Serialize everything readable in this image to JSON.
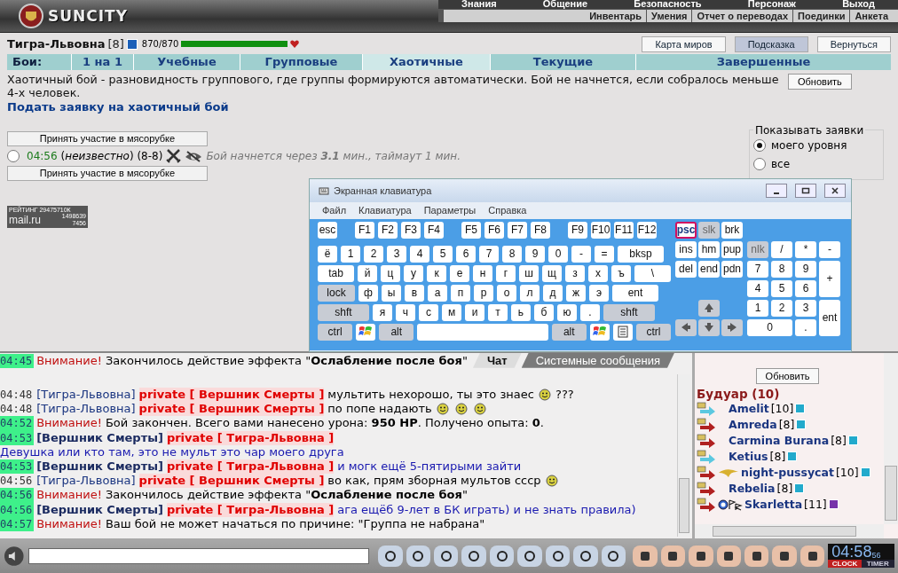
{
  "header": {
    "logo": "SUNCITY",
    "menu_top": [
      "Знания",
      "Общение",
      "Безопасность",
      "Персонаж",
      "Выход"
    ],
    "menu_bottom": [
      "Инвентарь",
      "Умения",
      "Отчет о переводах",
      "Поединки",
      "Анкета"
    ]
  },
  "player": {
    "name": "Тигра-Львовна",
    "rank": "[8]",
    "hp": "870/870",
    "hp_bar": {
      "level": 1
    }
  },
  "top_buttons": [
    {
      "label": "Карта миров",
      "selected": false
    },
    {
      "label": "Подсказка",
      "selected": true
    },
    {
      "label": "Вернуться",
      "selected": false
    }
  ],
  "fight_tabs": {
    "label": "Бои:",
    "tabs": [
      {
        "label": "1 на 1",
        "selected": false
      },
      {
        "label": "Учебные",
        "selected": false
      },
      {
        "label": "Групповые",
        "selected": false
      },
      {
        "label": "Хаотичные",
        "selected": true
      },
      {
        "label": "Текущие",
        "selected": false
      },
      {
        "label": "Завершенные",
        "selected": false
      }
    ]
  },
  "description": "Хаотичный бой - разновидность группового, где группы формируются автоматически. Бой не начнется, если собралось меньше 4-х человек.",
  "refresh_button": "Обновить",
  "apply_link": "Подать заявку на хаотичный бой",
  "filter": {
    "legend": "Показывать заявки",
    "options": [
      {
        "label": "моего уровня",
        "selected": true
      },
      {
        "label": "все",
        "selected": false
      }
    ]
  },
  "join_buttons": [
    "Принять участие в мясорубке",
    "Принять участие в мясорубке"
  ],
  "fight": {
    "selected": false,
    "time": "04:56",
    "players": "(*неизвестно*) (8-8)",
    "status": "Бой начнется через **3.1** мин., таймаут 1 мин."
  },
  "rating": {
    "title": "РЕЙТИНГ 29475710К",
    "logo": "mail.ru",
    "count_1": "1498639",
    "count_2": "7456"
  },
  "keyboard": {
    "title": "Экранная клавиатура",
    "menu": [
      "Файл",
      "Клавиатура",
      "Параметры",
      "Справка"
    ],
    "main": [
      [
        {
          "label": "esc",
          "kind": "key"
        },
        {
          "kind": "gap"
        },
        {
          "label": "F1",
          "kind": "key"
        },
        {
          "label": "F2",
          "kind": "key"
        },
        {
          "label": "F3",
          "kind": "key"
        },
        {
          "label": "F4",
          "kind": "key"
        },
        {
          "kind": "gap"
        },
        {
          "label": "F5",
          "kind": "key"
        },
        {
          "label": "F6",
          "kind": "key"
        },
        {
          "label": "F7",
          "kind": "key"
        },
        {
          "label": "F8",
          "kind": "key"
        },
        {
          "kind": "gap"
        },
        {
          "label": "F9",
          "kind": "key"
        },
        {
          "label": "F10",
          "kind": "key"
        },
        {
          "label": "F11",
          "kind": "key"
        },
        {
          "label": "F12",
          "kind": "key"
        }
      ],
      [
        {
          "label": "ё",
          "kind": "key"
        },
        {
          "label": "1",
          "kind": "key"
        },
        {
          "label": "2",
          "kind": "key"
        },
        {
          "label": "3",
          "kind": "key"
        },
        {
          "label": "4",
          "kind": "key"
        },
        {
          "label": "5",
          "kind": "key"
        },
        {
          "label": "6",
          "kind": "key"
        },
        {
          "label": "7",
          "kind": "key"
        },
        {
          "label": "8",
          "kind": "key"
        },
        {
          "label": "9",
          "kind": "key"
        },
        {
          "label": "0",
          "kind": "key"
        },
        {
          "label": "-",
          "kind": "key"
        },
        {
          "label": "=",
          "kind": "key"
        },
        {
          "label": "bksp",
          "kind": "wider"
        }
      ],
      [
        {
          "label": "tab",
          "kind": "wide"
        },
        {
          "label": "й",
          "kind": "key"
        },
        {
          "label": "ц",
          "kind": "key"
        },
        {
          "label": "у",
          "kind": "key"
        },
        {
          "label": "к",
          "kind": "key"
        },
        {
          "label": "е",
          "kind": "key"
        },
        {
          "label": "н",
          "kind": "key"
        },
        {
          "label": "г",
          "kind": "key"
        },
        {
          "label": "ш",
          "kind": "key"
        },
        {
          "label": "щ",
          "kind": "key"
        },
        {
          "label": "з",
          "kind": "key"
        },
        {
          "label": "х",
          "kind": "key"
        },
        {
          "label": "ъ",
          "kind": "key"
        },
        {
          "label": "\\",
          "kind": "wide"
        }
      ],
      [
        {
          "label": "lock",
          "kind": "mod"
        },
        {
          "label": "ф",
          "kind": "key"
        },
        {
          "label": "ы",
          "kind": "key"
        },
        {
          "label": "в",
          "kind": "key"
        },
        {
          "label": "а",
          "kind": "key"
        },
        {
          "label": "п",
          "kind": "key"
        },
        {
          "label": "р",
          "kind": "key"
        },
        {
          "label": "о",
          "kind": "key"
        },
        {
          "label": "л",
          "kind": "key"
        },
        {
          "label": "д",
          "kind": "key"
        },
        {
          "label": "ж",
          "kind": "key"
        },
        {
          "label": "э",
          "kind": "key"
        },
        {
          "label": "ent",
          "kind": "wider"
        }
      ],
      [
        {
          "label": "shft",
          "kind": "modwide"
        },
        {
          "label": "я",
          "kind": "key"
        },
        {
          "label": "ч",
          "kind": "key"
        },
        {
          "label": "с",
          "kind": "key"
        },
        {
          "label": "м",
          "kind": "key"
        },
        {
          "label": "и",
          "kind": "key"
        },
        {
          "label": "т",
          "kind": "key"
        },
        {
          "label": "ь",
          "kind": "key"
        },
        {
          "label": "б",
          "kind": "key"
        },
        {
          "label": "ю",
          "kind": "key"
        },
        {
          "label": ".",
          "kind": "key"
        },
        {
          "label": "shft",
          "kind": "modwide"
        }
      ],
      [
        {
          "label": "ctrl",
          "kind": "mod"
        },
        {
          "kind": "logo"
        },
        {
          "label": "alt",
          "kind": "mod"
        },
        {
          "kind": "space"
        },
        {
          "label": "alt",
          "kind": "mod"
        },
        {
          "kind": "logo"
        },
        {
          "kind": "menu"
        },
        {
          "label": "ctrl",
          "kind": "mod"
        }
      ]
    ],
    "nav": [
      {
        "label": "psc",
        "kind": "active"
      },
      {
        "label": "slk",
        "kind": "dim"
      },
      {
        "label": "brk",
        "kind": "key"
      },
      {
        "label": "ins",
        "kind": "key"
      },
      {
        "label": "hm",
        "kind": "key"
      },
      {
        "label": "pup",
        "kind": "key"
      },
      {
        "label": "del",
        "kind": "key"
      },
      {
        "label": "end",
        "kind": "key"
      },
      {
        "label": "pdn",
        "kind": "key"
      },
      {
        "kind": "blank"
      },
      {
        "kind": "blank"
      },
      {
        "kind": "blank"
      },
      {
        "kind": "blank"
      },
      {
        "kind": "up"
      },
      {
        "kind": "blank"
      },
      {
        "kind": "left"
      },
      {
        "kind": "down"
      },
      {
        "kind": "right"
      }
    ],
    "numpad": [
      {
        "kind": "blank"
      },
      {
        "kind": "blank"
      },
      {
        "kind": "blank"
      },
      {
        "kind": "blank"
      },
      {
        "label": "nlk",
        "kind": "dim"
      },
      {
        "label": "/",
        "kind": "key"
      },
      {
        "label": "*",
        "kind": "key"
      },
      {
        "label": "-",
        "kind": "key"
      },
      {
        "label": "7",
        "kind": "key"
      },
      {
        "label": "8",
        "kind": "key"
      },
      {
        "label": "9",
        "kind": "key"
      },
      {
        "label": "+",
        "kind": "tall"
      },
      {
        "label": "4",
        "kind": "key"
      },
      {
        "label": "5",
        "kind": "key"
      },
      {
        "label": "6",
        "kind": "key"
      },
      {
        "label": "1",
        "kind": "key"
      },
      {
        "label": "2",
        "kind": "key"
      },
      {
        "label": "3",
        "kind": "key"
      },
      {
        "label": "ent",
        "kind": "tall"
      },
      {
        "label": "0",
        "kind": "zero"
      },
      {
        "label": ".",
        "kind": "key"
      }
    ]
  },
  "chat_tabs": [
    {
      "label": "Чат",
      "selected": true
    },
    {
      "label": "Системные сообщения",
      "selected": false
    }
  ],
  "chat": [
    {
      "time": "04:45",
      "highlighted": true,
      "kind": "system",
      "label": "Внимание!",
      "parts": [
        {
          "kind": "text",
          "text": "Закончилось действие эффекта \"**Ослабление после боя**\""
        }
      ]
    },
    {
      "time": "04:48",
      "highlighted": false,
      "kind": "outgoing",
      "sender": "[Тигра-Львовна]",
      "target": "private [ Вершник Смерты ]",
      "parts": [
        {
          "kind": "text",
          "text": "мультить нехорошо, ты это знаес"
        },
        {
          "kind": "smiley"
        },
        {
          "kind": "text",
          "text": "???"
        }
      ]
    },
    {
      "time": "04:48",
      "highlighted": false,
      "kind": "outgoing",
      "sender": "[Тигра-Львовна]",
      "target": "private [ Вершник Смерты ]",
      "parts": [
        {
          "kind": "text",
          "text": "по попе надають"
        },
        {
          "kind": "smiley"
        },
        {
          "kind": "smiley"
        },
        {
          "kind": "smiley"
        }
      ]
    },
    {
      "time": "04:52",
      "highlighted": true,
      "kind": "system",
      "label": "Внимание!",
      "parts": [
        {
          "kind": "text",
          "text": "Бой закончен. Всего вами нанесено урона: **950 HP**. Получено опыта: **0**."
        }
      ]
    },
    {
      "time": "04:53",
      "highlighted": true,
      "kind": "incoming",
      "sender": "[Вершник Смерты]",
      "target": "private [ Тигра-Львовна ]",
      "parts": [
        {
          "kind": "text",
          "text": "Девушка или кто там, это не мульт это чар моего друга"
        }
      ]
    },
    {
      "time": "04:53",
      "highlighted": true,
      "kind": "incoming",
      "sender": "[Вершник Смерты]",
      "target": "private [ Тигра-Львовна ]",
      "parts": [
        {
          "kind": "text",
          "text": "и могк ещё 5-пятирыми зайти"
        }
      ]
    },
    {
      "time": "04:56",
      "highlighted": false,
      "kind": "outgoing",
      "sender": "[Тигра-Львовна]",
      "target": "private [ Вершник Смерты ]",
      "parts": [
        {
          "kind": "text",
          "text": "во как, прям зборная мультов ссср"
        },
        {
          "kind": "smiley"
        }
      ]
    },
    {
      "time": "04:56",
      "highlighted": true,
      "kind": "system",
      "label": "Внимание!",
      "parts": [
        {
          "kind": "text",
          "text": "Закончилось действие эффекта \"**Ослабление после боя**\""
        }
      ]
    },
    {
      "time": "04:56",
      "highlighted": true,
      "kind": "incoming",
      "sender": "[Вершник Смерты]",
      "target": "private [ Тигра-Львовна ]",
      "parts": [
        {
          "kind": "text",
          "text": "ага ещёб 9-лет в БК играть) и не знать правила)"
        }
      ]
    },
    {
      "time": "04:57",
      "highlighted": true,
      "kind": "system",
      "label": "Внимание!",
      "parts": [
        {
          "kind": "text",
          "text": "Ваш бой не может начаться по причине: \"Группа не набрана\""
        }
      ]
    }
  ],
  "room": {
    "refresh_button": "Обновить",
    "title": "Будуар (10)",
    "users": [
      {
        "name": "Amelit",
        "level": "[10]",
        "color": "#5cc8e0",
        "kind": "plain"
      },
      {
        "name": "Amreda",
        "level": "[8]",
        "color": "#b02020",
        "kind": "plain"
      },
      {
        "name": "Carmina Burana",
        "level": "[8]",
        "color": "#b02020",
        "kind": "plain"
      },
      {
        "name": "Ketius",
        "level": "[8]",
        "color": "#5cc8e0",
        "kind": "plain"
      },
      {
        "name": "night-pussycat",
        "level": "[10]",
        "color": "#b02020",
        "kind": "wing"
      },
      {
        "name": "Rebelia",
        "level": "[8]",
        "color": "#b02020",
        "kind": "plain"
      },
      {
        "name": "Skarletta",
        "level": "[11]",
        "color": "#b02020",
        "kind": "clan"
      }
    ]
  },
  "clock": {
    "time": "04:58",
    "seconds": "56",
    "tabs": [
      {
        "label": "CLOCK",
        "selected": true
      },
      {
        "label": "TIMER",
        "selected": false
      }
    ]
  }
}
